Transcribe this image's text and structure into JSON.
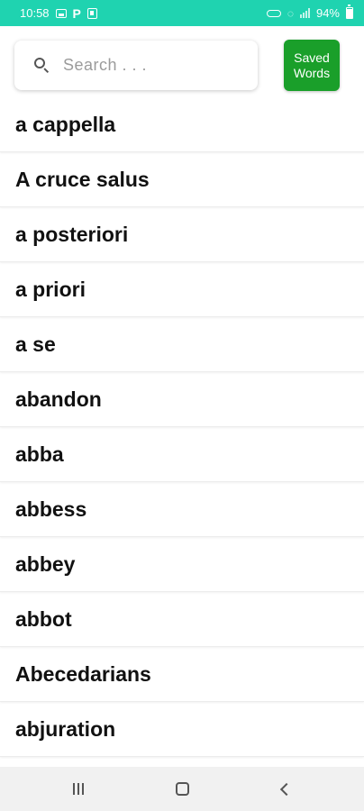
{
  "status_bar": {
    "time": "10:58",
    "p_label": "P",
    "battery": "94%",
    "background": "#1fd3b0"
  },
  "search": {
    "placeholder": "Search . . ."
  },
  "saved_button": {
    "line1": "Saved",
    "line2": "Words",
    "color": "#1a9f2a"
  },
  "words": [
    "a cappella",
    "A cruce salus",
    "a posteriori",
    "a priori",
    "a se",
    "abandon",
    "abba",
    "abbess",
    "abbey",
    "abbot",
    "Abecedarians",
    "abjuration"
  ],
  "icons": {
    "status_left": [
      "gallery-icon",
      "p-icon",
      "box-icon"
    ],
    "status_right": [
      "link-icon",
      "wifi-icon",
      "signal-icon",
      "battery-icon"
    ],
    "search": "search-icon",
    "nav": [
      "recent-apps-icon",
      "home-icon",
      "back-icon"
    ]
  }
}
